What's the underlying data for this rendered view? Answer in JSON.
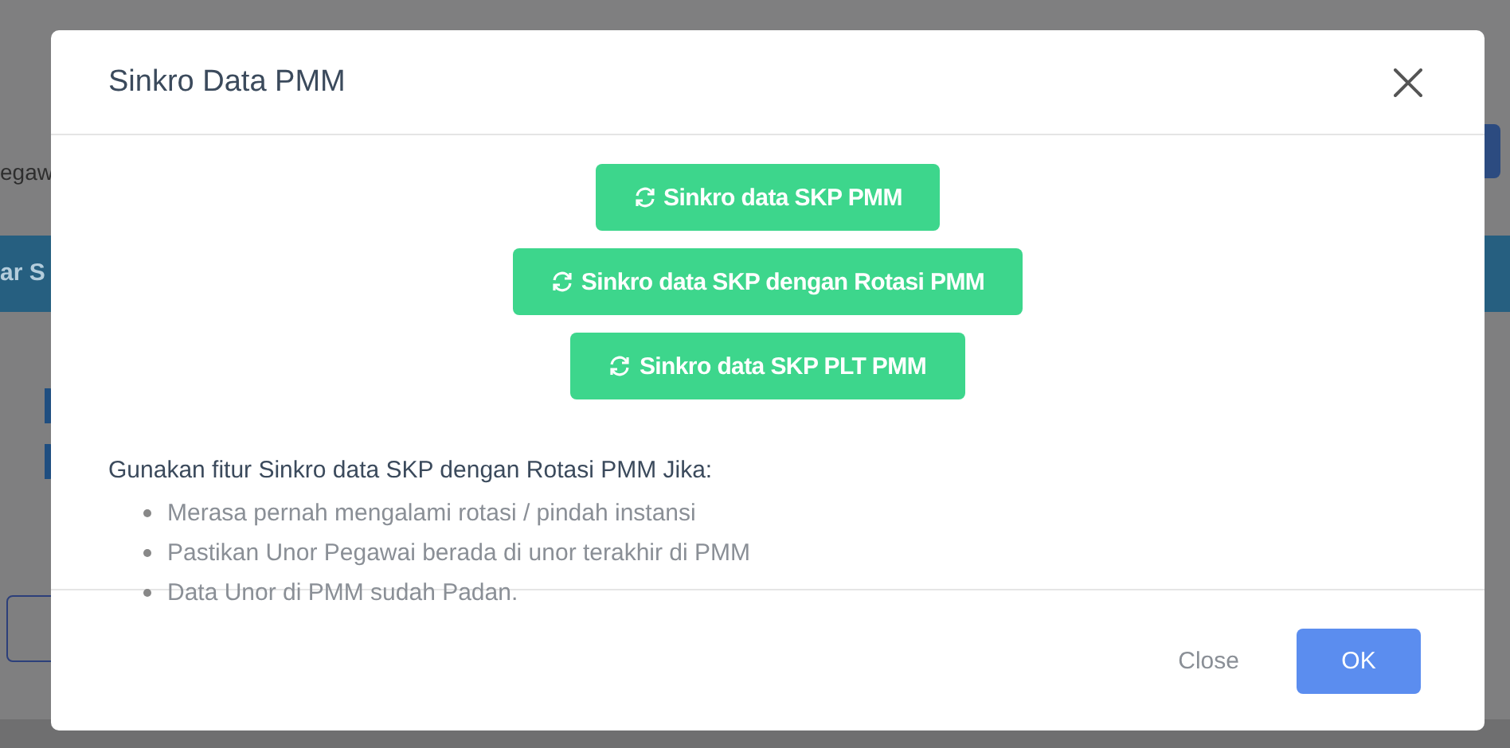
{
  "background": {
    "field_label": "egaw",
    "banner": "ar S"
  },
  "dialog": {
    "title": "Sinkro Data PMM",
    "actions": [
      {
        "label": "Sinkro data SKP PMM"
      },
      {
        "label": "Sinkro data SKP dengan Rotasi PMM"
      },
      {
        "label": "Sinkro data SKP PLT PMM"
      }
    ],
    "intro": "Gunakan fitur Sinkro data SKP dengan Rotasi PMM Jika:",
    "points": [
      "Merasa pernah mengalami rotasi / pindah instansi",
      "Pastikan Unor Pegawai berada di unor terakhir di PMM",
      "Data Unor di PMM sudah Padan."
    ],
    "footer": {
      "close": "Close",
      "ok": "OK"
    }
  }
}
